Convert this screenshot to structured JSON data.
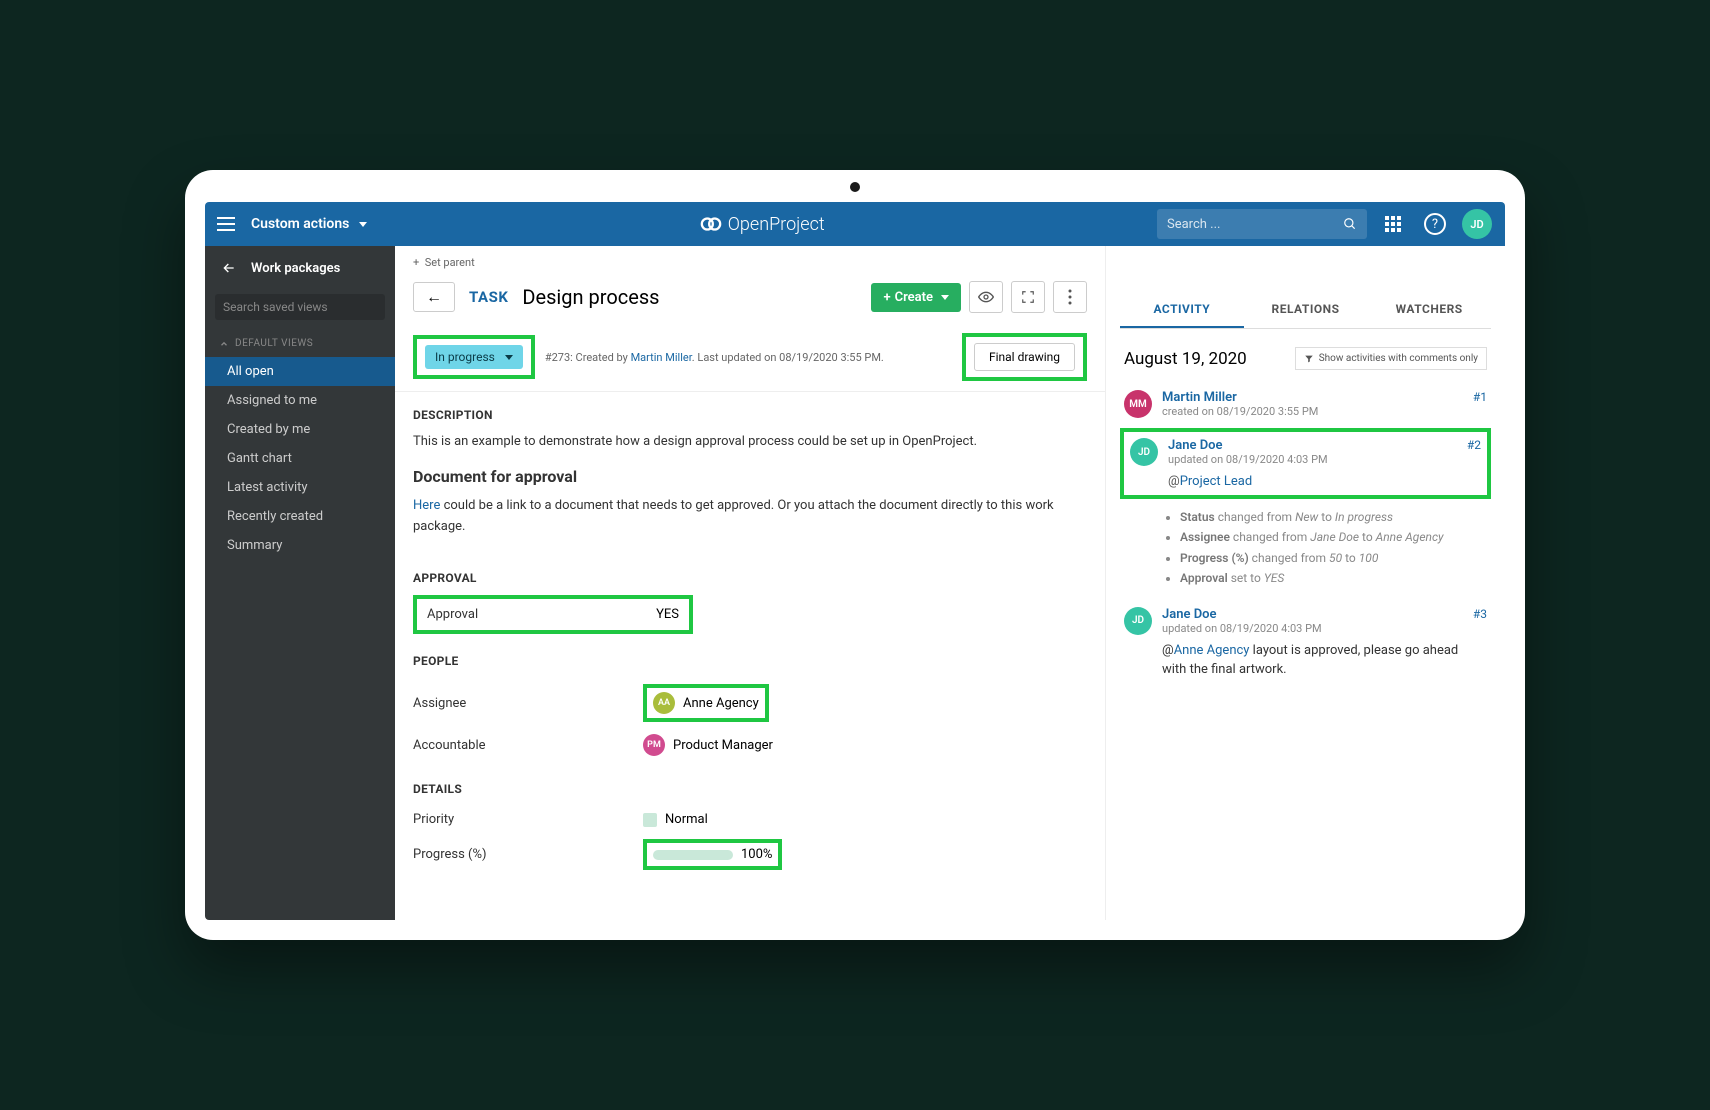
{
  "header": {
    "breadcrumb": "Custom actions",
    "brand": "OpenProject",
    "search_placeholder": "Search ...",
    "user_initials": "JD"
  },
  "sidebar": {
    "title": "Work packages",
    "search_placeholder": "Search saved views",
    "group_label": "DEFAULT VIEWS",
    "items": [
      "All open",
      "Assigned to me",
      "Created by me",
      "Gantt chart",
      "Latest activity",
      "Recently created",
      "Summary"
    ]
  },
  "wp": {
    "set_parent": "Set parent",
    "type": "TASK",
    "title": "Design process",
    "create_label": "Create",
    "status": "In progress",
    "meta_prefix": "#273: Created by ",
    "meta_author": "Martin Miller",
    "meta_suffix": ". Last updated on 08/19/2020 3:55 PM.",
    "custom_action": "Final drawing",
    "description_heading": "DESCRIPTION",
    "desc_p1": "This is an example to demonstrate how a design approval process could be set up in OpenProject.",
    "desc_sub": "Document for approval",
    "desc_link": "Here",
    "desc_p2": " could be a link to a document that needs to get approved. Or you attach the document directly to this work package.",
    "approval_heading": "APPROVAL",
    "approval_label": "Approval",
    "approval_value": "YES",
    "people_heading": "PEOPLE",
    "assignee_label": "Assignee",
    "assignee_value": "Anne Agency",
    "assignee_initials": "AA",
    "accountable_label": "Accountable",
    "accountable_value": "Product Manager",
    "accountable_initials": "PM",
    "details_heading": "DETAILS",
    "priority_label": "Priority",
    "priority_value": "Normal",
    "progress_label": "Progress (%)",
    "progress_value": "100%"
  },
  "activity": {
    "tabs": [
      "ACTIVITY",
      "RELATIONS",
      "WATCHERS"
    ],
    "date": "August 19, 2020",
    "filter": "Show activities with comments only",
    "entries": [
      {
        "initials": "MM",
        "author": "Martin Miller",
        "time": "created on 08/19/2020 3:55 PM",
        "num": "#1"
      },
      {
        "initials": "JD",
        "author": "Jane Doe",
        "time": "updated on 08/19/2020 4:03 PM",
        "num": "#2",
        "mention": "Project Lead"
      },
      {
        "initials": "JD",
        "author": "Jane Doe",
        "time": "updated on 08/19/2020 4:03 PM",
        "num": "#3",
        "comment_mention": "Anne Agency",
        "comment": " layout is approved, please go ahead with the final artwork."
      }
    ],
    "changes": [
      {
        "field": "Status",
        "verb": "changed from",
        "from": "New",
        "to": "In progress"
      },
      {
        "field": "Assignee",
        "verb": "changed from",
        "from": "Jane Doe",
        "to": "Anne Agency"
      },
      {
        "field": "Progress (%)",
        "verb": "changed from",
        "from": "50",
        "to": "100"
      },
      {
        "field": "Approval",
        "verb": "set to",
        "to": "YES"
      }
    ]
  }
}
